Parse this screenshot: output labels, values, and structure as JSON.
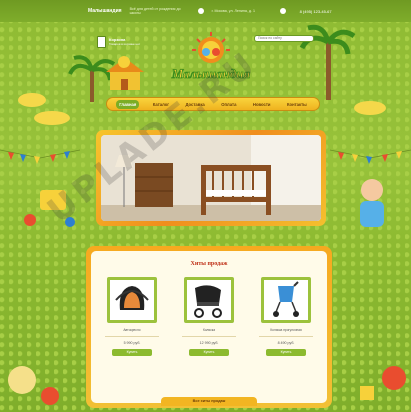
{
  "header": {
    "brand": "Малышандия",
    "tagline": "Всё для детей от рождения до школы",
    "address": "г. Москва, ул. Ленина, д. 1",
    "phone": "8 (495) 123-45-67"
  },
  "cart": {
    "title": "Корзина",
    "subtitle": "Товаров в корзине нет"
  },
  "search": {
    "placeholder": "Поиск по сайту"
  },
  "logo": {
    "text": "Малышандия"
  },
  "nav": {
    "items": [
      {
        "label": "Главная",
        "active": true
      },
      {
        "label": "Каталог",
        "active": false
      },
      {
        "label": "Доставка",
        "active": false
      },
      {
        "label": "Оплата",
        "active": false
      },
      {
        "label": "Новости",
        "active": false
      },
      {
        "label": "Контакты",
        "active": false
      }
    ]
  },
  "products_section": {
    "title": "Хиты продаж",
    "items": [
      {
        "name": "Автокресло",
        "price": "5 990 руб.",
        "buy": "Купить"
      },
      {
        "name": "Коляска",
        "price": "12 990 руб.",
        "buy": "Купить"
      },
      {
        "name": "Коляска прогулочная",
        "price": "8 490 руб.",
        "buy": "Купить"
      }
    ],
    "all_link": "Все хиты продаж"
  },
  "watermark": "UPLADE.RU",
  "colors": {
    "grass": "#9cc23c",
    "orange": "#f2a91f",
    "nav_yellow": "#f9d43c",
    "red_title": "#c0331a"
  }
}
